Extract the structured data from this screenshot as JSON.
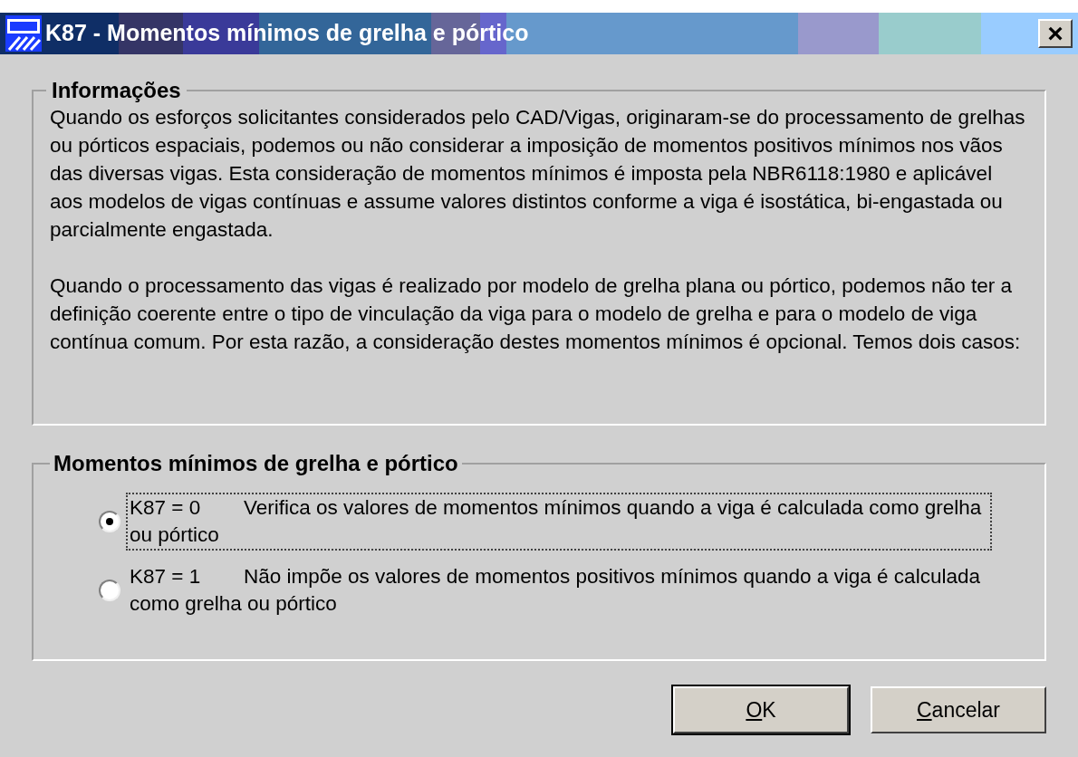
{
  "window": {
    "title": "K87 - Momentos mínimos de grelha e pórtico",
    "close": "×"
  },
  "info": {
    "title": "Informações",
    "paragraphs": [
      "Quando os esforços solicitantes considerados pelo CAD/Vigas, originaram-se do processamento de grelhas ou pórticos espaciais, podemos ou não considerar a imposição de momentos positivos mínimos nos vãos das diversas vigas. Esta consideração de momentos mínimos é imposta pela NBR6118:1980 e aplicável aos modelos de vigas contínuas e assume valores distintos conforme a viga é isostática, bi-engastada ou parcialmente engastada.",
      "Quando o processamento das vigas é realizado por modelo de grelha plana ou pórtico, podemos não ter a definição coerente entre o tipo de vinculação da viga para o modelo de grelha e para o modelo de viga contínua comum. Por esta razão, a consideração destes momentos mínimos é opcional. Temos dois casos:"
    ]
  },
  "options": {
    "title": "Momentos mínimos de grelha e pórtico",
    "items": [
      {
        "code": "K87 = 0",
        "description": "Verifica os valores de momentos mínimos quando a viga é calculada como grelha ou pórtico",
        "selected": true,
        "focused": true
      },
      {
        "code": "K87 = 1",
        "description": "Não impõe os valores de momentos positivos mínimos quando a viga é calculada como grelha ou pórtico",
        "selected": false,
        "focused": false
      }
    ]
  },
  "buttons": [
    {
      "label": "OK",
      "default": true
    },
    {
      "label": "Cancelar",
      "default": false
    }
  ]
}
